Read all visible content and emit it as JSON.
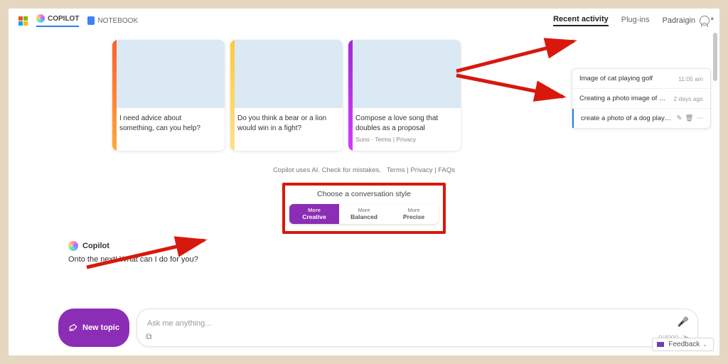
{
  "header": {
    "copilot_label": "COPILOT",
    "notebook_label": "NOTEBOOK",
    "tabs": {
      "recent": "Recent activity",
      "plugins": "Plug-ins"
    },
    "username": "Padraigin"
  },
  "cards": [
    {
      "accent": "linear-gradient(#ff5f2e,#ffa83a)",
      "caption": "I need advice about something, can you help?",
      "sub": ""
    },
    {
      "accent": "linear-gradient(#ffc83a,#ffe08a)",
      "caption": "Do you think a bear or a lion would win in a fight?",
      "sub": ""
    },
    {
      "accent": "linear-gradient(#a02bd0,#d33aff)",
      "caption": "Compose a love song that doubles as a proposal",
      "sub": "Suno · Terms | Privacy"
    }
  ],
  "disclaimer": {
    "text": "Copilot uses AI. Check for mistakes.",
    "links": [
      "Terms",
      "Privacy",
      "FAQs"
    ]
  },
  "style_picker": {
    "title": "Choose a conversation style",
    "options": [
      {
        "top": "More",
        "bot": "Creative",
        "active": true
      },
      {
        "top": "More",
        "bot": "Balanced",
        "active": false
      },
      {
        "top": "More",
        "bot": "Precise",
        "active": false
      }
    ]
  },
  "chat": {
    "agent_name": "Copilot",
    "greeting": "Onto the next! What can I do for you?"
  },
  "input": {
    "new_topic": "New topic",
    "placeholder": "Ask me anything...",
    "counter": "0/4000"
  },
  "recent": {
    "items": [
      {
        "title": "Image of cat playing golf",
        "time": "11:05 am"
      },
      {
        "title": "Creating a photo image of a tropical be",
        "time": "2 days ago"
      },
      {
        "title": "create a photo of a dog playing a g",
        "time": ""
      }
    ]
  },
  "feedback_label": "Feedback"
}
